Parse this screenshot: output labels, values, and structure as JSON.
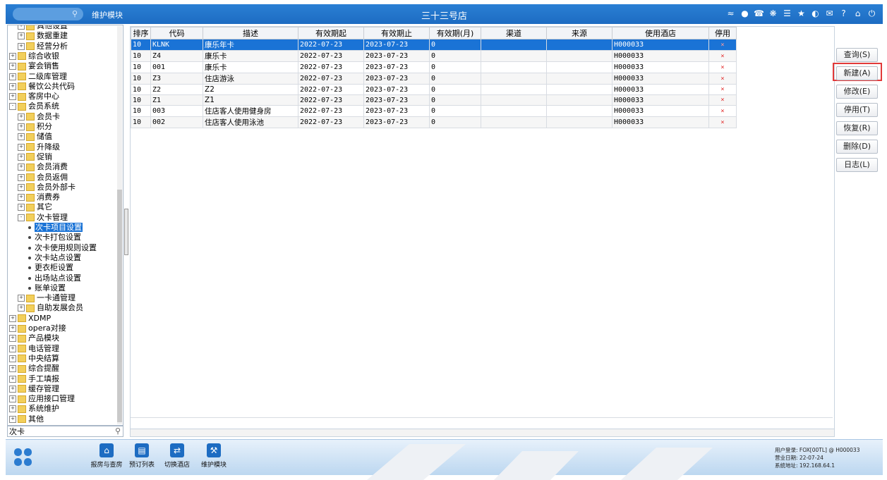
{
  "topbar": {
    "module": "维护模块",
    "store": "三十三号店",
    "icons": [
      "wifi-icon",
      "chat-icon",
      "phone-icon",
      "palette-icon",
      "menu-icon",
      "star-icon",
      "moon-icon",
      "mail-icon",
      "help-icon",
      "home-icon",
      "power-icon"
    ]
  },
  "tree": {
    "items": [
      {
        "label": "具他设置",
        "level": 1,
        "type": "folder",
        "pm": "+"
      },
      {
        "label": "数据重建",
        "level": 1,
        "type": "folder",
        "pm": "+"
      },
      {
        "label": "经营分析",
        "level": 1,
        "type": "folder",
        "pm": "+"
      },
      {
        "label": "综合收银",
        "level": 0,
        "type": "folder",
        "pm": "+"
      },
      {
        "label": "宴会销售",
        "level": 0,
        "type": "folder",
        "pm": "+"
      },
      {
        "label": "二级库管理",
        "level": 0,
        "type": "folder",
        "pm": "+"
      },
      {
        "label": "餐饮公共代码",
        "level": 0,
        "type": "folder",
        "pm": "+"
      },
      {
        "label": "客房中心",
        "level": 0,
        "type": "folder",
        "pm": "+"
      },
      {
        "label": "会员系统",
        "level": 0,
        "type": "folder",
        "pm": "-"
      },
      {
        "label": "会员卡",
        "level": 1,
        "type": "folder",
        "pm": "+"
      },
      {
        "label": "积分",
        "level": 1,
        "type": "folder",
        "pm": "+"
      },
      {
        "label": "储值",
        "level": 1,
        "type": "folder",
        "pm": "+"
      },
      {
        "label": "升降级",
        "level": 1,
        "type": "folder",
        "pm": "+"
      },
      {
        "label": "促销",
        "level": 1,
        "type": "folder",
        "pm": "+"
      },
      {
        "label": "会员消费",
        "level": 1,
        "type": "folder",
        "pm": "+"
      },
      {
        "label": "会员返佣",
        "level": 1,
        "type": "folder",
        "pm": "+"
      },
      {
        "label": "会员外部卡",
        "level": 1,
        "type": "folder",
        "pm": "+"
      },
      {
        "label": "消费券",
        "level": 1,
        "type": "folder",
        "pm": "+"
      },
      {
        "label": "其它",
        "level": 1,
        "type": "folder",
        "pm": "+"
      },
      {
        "label": "次卡管理",
        "level": 1,
        "type": "folder",
        "pm": "-"
      },
      {
        "label": "次卡项目设置",
        "level": 2,
        "type": "leaf",
        "selected": true
      },
      {
        "label": "次卡打包设置",
        "level": 2,
        "type": "leaf"
      },
      {
        "label": "次卡使用规则设置",
        "level": 2,
        "type": "leaf"
      },
      {
        "label": "次卡站点设置",
        "level": 2,
        "type": "leaf"
      },
      {
        "label": "更衣柜设置",
        "level": 2,
        "type": "leaf"
      },
      {
        "label": "出场站点设置",
        "level": 2,
        "type": "leaf"
      },
      {
        "label": "账单设置",
        "level": 2,
        "type": "leaf"
      },
      {
        "label": "一卡通管理",
        "level": 1,
        "type": "folder",
        "pm": "+"
      },
      {
        "label": "自助发展会员",
        "level": 1,
        "type": "folder",
        "pm": "+"
      },
      {
        "label": "XDMP",
        "level": 0,
        "type": "folder",
        "pm": "+"
      },
      {
        "label": "opera对接",
        "level": 0,
        "type": "folder",
        "pm": "+"
      },
      {
        "label": "产品模块",
        "level": 0,
        "type": "folder",
        "pm": "+"
      },
      {
        "label": "电话管理",
        "level": 0,
        "type": "folder",
        "pm": "+"
      },
      {
        "label": "中央结算",
        "level": 0,
        "type": "folder",
        "pm": "+"
      },
      {
        "label": "综合提醒",
        "level": 0,
        "type": "folder",
        "pm": "+"
      },
      {
        "label": "手工填报",
        "level": 0,
        "type": "folder",
        "pm": "+"
      },
      {
        "label": "缓存管理",
        "level": 0,
        "type": "folder",
        "pm": "+"
      },
      {
        "label": "应用接口管理",
        "level": 0,
        "type": "folder",
        "pm": "+"
      },
      {
        "label": "系统维护",
        "level": 0,
        "type": "folder",
        "pm": "+"
      },
      {
        "label": "其他",
        "level": 0,
        "type": "folder",
        "pm": "+"
      }
    ],
    "search_value": "次卡"
  },
  "grid": {
    "columns": [
      "排序",
      "代码",
      "描述",
      "有效期起",
      "有效期止",
      "有效期(月)",
      "渠道",
      "来源",
      "使用酒店",
      "停用"
    ],
    "rows": [
      [
        "10",
        "KLNK",
        "康乐年卡",
        "2022-07-23",
        "2023-07-23",
        "0",
        "",
        "",
        "H000033",
        "×"
      ],
      [
        "10",
        "Z4",
        "康乐卡",
        "2022-07-23",
        "2023-07-23",
        "0",
        "",
        "",
        "H000033",
        "×"
      ],
      [
        "10",
        "001",
        "康乐卡",
        "2022-07-23",
        "2023-07-23",
        "0",
        "",
        "",
        "H000033",
        "×"
      ],
      [
        "10",
        "Z3",
        "住店游泳",
        "2022-07-23",
        "2023-07-23",
        "0",
        "",
        "",
        "H000033",
        "×"
      ],
      [
        "10",
        "Z2",
        "Z2",
        "2022-07-23",
        "2023-07-23",
        "0",
        "",
        "",
        "H000033",
        "×"
      ],
      [
        "10",
        "Z1",
        "Z1",
        "2022-07-23",
        "2023-07-23",
        "0",
        "",
        "",
        "H000033",
        "×"
      ],
      [
        "10",
        "003",
        "住店客人使用健身房",
        "2022-07-23",
        "2023-07-23",
        "0",
        "",
        "",
        "H000033",
        "×"
      ],
      [
        "10",
        "002",
        "住店客人使用泳池",
        "2022-07-23",
        "2023-07-23",
        "0",
        "",
        "",
        "H000033",
        "×"
      ]
    ],
    "selected_row": 0
  },
  "actions": {
    "query": "查询(S)",
    "new": "新建(A)",
    "modify": "修改(E)",
    "disable": "停用(T)",
    "restore": "恢复(R)",
    "delete": "删除(D)",
    "log": "日志(L)"
  },
  "taskbar": {
    "items": [
      {
        "label": "报房与查房",
        "icon": "house-icon"
      },
      {
        "label": "预订列表",
        "icon": "clipboard-icon"
      },
      {
        "label": "切换酒店",
        "icon": "switch-icon"
      },
      {
        "label": "维护模块",
        "icon": "wrench-icon"
      }
    ],
    "status": {
      "user": "用户登录:  FOX[00TL] @ H000033",
      "date": "营业日期:  22-07-24",
      "ip": "系统地址:  192.168.64.1"
    }
  }
}
